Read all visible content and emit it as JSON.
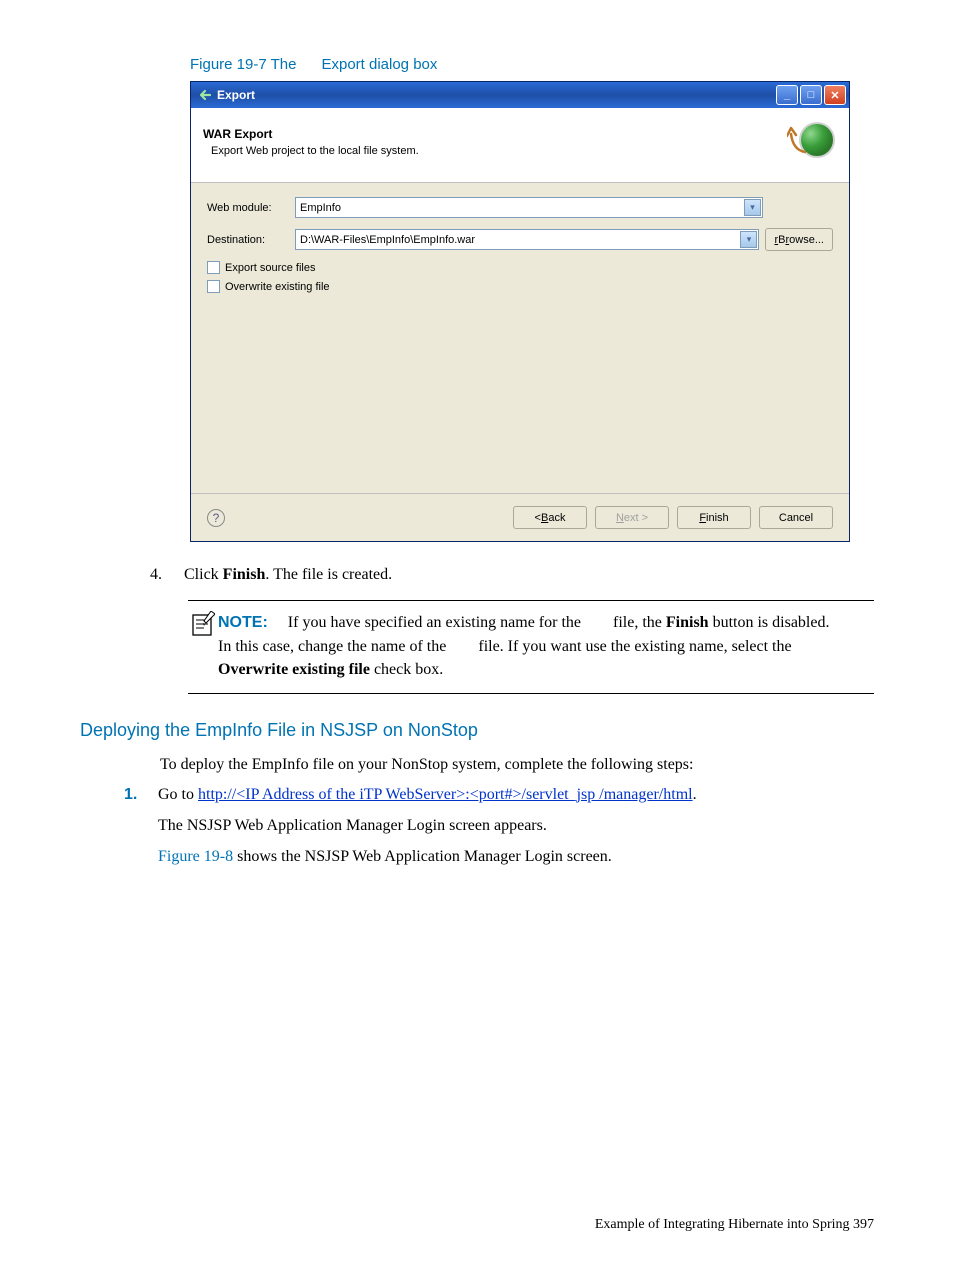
{
  "figure_caption": {
    "prefix": "Figure 19-7 The",
    "suffix": "Export dialog box"
  },
  "dialog": {
    "title": "Export",
    "header_title": "WAR Export",
    "header_sub": "Export Web project to the local file system.",
    "web_module_label": "Web module:",
    "web_module_value": "EmpInfo",
    "destination_label": "Destination:",
    "destination_value": "D:\\WAR-Files\\EmpInfo\\EmpInfo.war",
    "browse_label": "Browse...",
    "export_source_label": "Export source files",
    "overwrite_label": "Overwrite existing file",
    "back_btn_left": "< ",
    "back_btn_u": "B",
    "back_btn_rest": "ack",
    "next_btn_u": "N",
    "next_btn_rest": "ext >",
    "finish_btn_u": "F",
    "finish_btn_rest": "inish",
    "cancel_btn": "Cancel"
  },
  "step4": {
    "num": "4.",
    "pre": "Click ",
    "bold": "Finish",
    "post": ". The        file is created."
  },
  "note": {
    "label": "NOTE:",
    "line1_a": "If you have specified an existing name for the",
    "line1_b": "file, the ",
    "line1_bold": "Finish",
    "line1_c": " button is disabled.",
    "line2_a": "In this case, change the name of the",
    "line2_b": "file. If you want use the existing name, select the ",
    "line2_bold": "Overwrite existing file",
    "line2_c": " check box."
  },
  "h3_text": "Deploying the EmpInfo       File in NSJSP on NonStop",
  "deploy_intro": "To deploy the EmpInfo        file on your NonStop system, complete the following steps:",
  "step1": {
    "num": "1.",
    "pre": "Go to ",
    "link": "http://<IP Address of the iTP WebServer>:<port#>/servlet_jsp /manager/html",
    "post": "."
  },
  "sub1": "The NSJSP Web Application Manager Login screen appears.",
  "sub2_ref": "Figure 19-8",
  "sub2_rest": " shows the NSJSP Web Application Manager Login screen.",
  "footer": "Example of Integrating Hibernate into Spring    397"
}
